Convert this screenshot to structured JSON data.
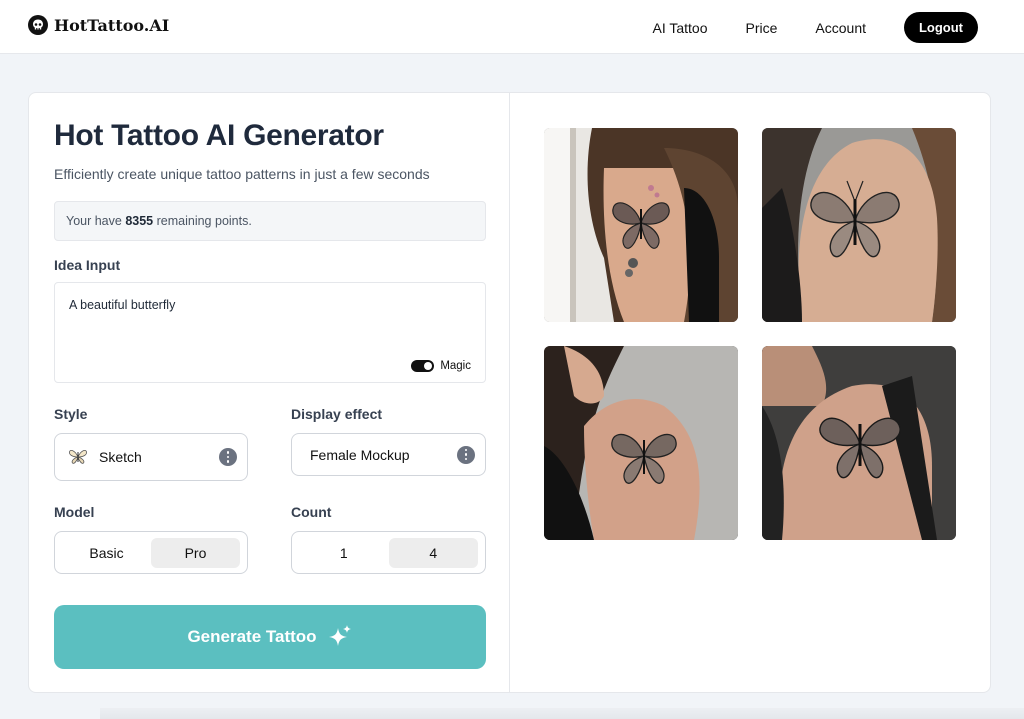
{
  "header": {
    "brand": "HotTattoo.AI",
    "nav": [
      "AI Tattoo",
      "Price",
      "Account"
    ],
    "logout_label": "Logout"
  },
  "generator": {
    "title": "Hot Tattoo AI Generator",
    "subtitle": "Efficiently create unique tattoo patterns in just a few seconds",
    "points_prefix": "Your have",
    "points_value": "8355",
    "points_suffix": "remaining points.",
    "idea_label": "Idea Input",
    "idea_value": "A beautiful butterfly",
    "magic_label": "Magic",
    "magic_on": true,
    "style_label": "Style",
    "style_value": "Sketch",
    "display_label": "Display effect",
    "display_value": "Female Mockup",
    "model_label": "Model",
    "model_options": [
      "Basic",
      "Pro"
    ],
    "model_selected": "Pro",
    "count_label": "Count",
    "count_options": [
      "1",
      "4"
    ],
    "count_selected": "4",
    "generate_label": "Generate Tattoo"
  },
  "gallery": {
    "images": [
      {
        "subject": "butterfly-tattoo-upper-arm-side-view"
      },
      {
        "subject": "butterfly-tattoo-shoulder-back-view"
      },
      {
        "subject": "butterfly-tattoo-shoulder-profile"
      },
      {
        "subject": "butterfly-tattoo-shoulder-closeup"
      }
    ]
  },
  "colors": {
    "accent": "#5bbfc0",
    "dark": "#000000",
    "title": "#1f2a3c"
  },
  "icons": {
    "brand": "skull-icon",
    "style": "butterfly-icon",
    "info": "more-dots-icon",
    "generate": "sparkle-icon"
  }
}
